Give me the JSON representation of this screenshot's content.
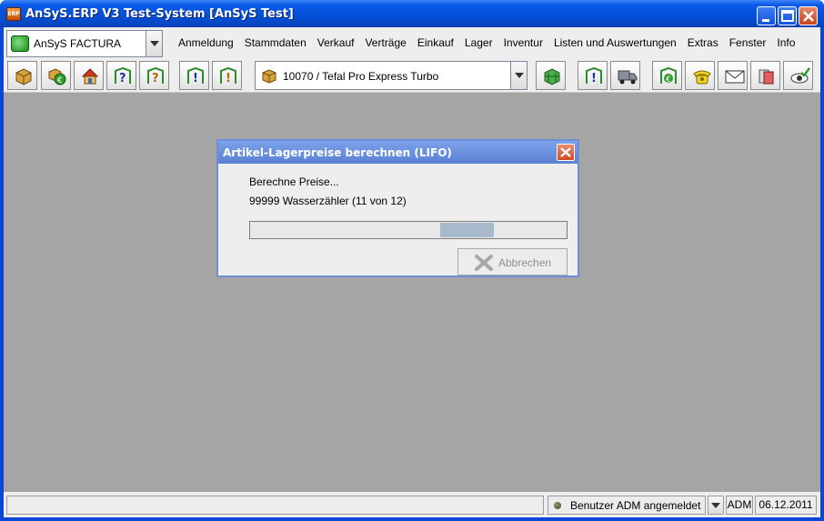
{
  "window": {
    "title": "AnSyS.ERP V3 Test-System [AnSyS Test]",
    "app_icon_text": "ERP",
    "controls": [
      "minimize-icon",
      "maximize-icon",
      "close-icon"
    ]
  },
  "menubar": {
    "module_select": {
      "value": "AnSyS FACTURA",
      "icon": "factura-module-icon"
    },
    "items": [
      {
        "label": "Anmeldung"
      },
      {
        "label": "Stammdaten"
      },
      {
        "label": "Verkauf"
      },
      {
        "label": "Verträge"
      },
      {
        "label": "Einkauf"
      },
      {
        "label": "Lager"
      },
      {
        "label": "Inventur"
      },
      {
        "label": "Listen und Auswertungen"
      },
      {
        "label": "Extras"
      },
      {
        "label": "Fenster"
      },
      {
        "label": "Info"
      }
    ]
  },
  "toolbar": {
    "article_select": {
      "value": "10070 / Tefal Pro Express Turbo",
      "icon": "article-box-icon"
    },
    "buttons_left": [
      "article-box-icon",
      "article-euro-icon",
      "warehouse-home-icon",
      "article-question-icon",
      "article-search-question-icon",
      "info-exclamation-icon",
      "search-info-icon"
    ],
    "buttons_right": [
      "stock-grid-icon",
      "order-info-icon",
      "delivery-truck-icon",
      "euro-refresh-icon",
      "telephone-icon",
      "envelope-icon",
      "documents-icon",
      "view-check-icon"
    ]
  },
  "dialog": {
    "title": "Artikel-Lagerpreise berechnen (LIFO)",
    "message": "Berechne Preise...",
    "current_item": "99999 Wasserzähler (11 von 12)",
    "progress": {
      "fill_start": 0.6,
      "fill_end": 0.77
    },
    "cancel_label": "Abbrechen"
  },
  "statusbar": {
    "main_text": "",
    "user_status": "Benutzer ADM angemeldet",
    "user_code": "ADM",
    "date": "06.12.2011"
  },
  "colors": {
    "titlebar": "#0552d8",
    "workspace": "#a5a5a5",
    "dialog_title": "#6a8fdf",
    "progress_fill": "#a9b9cc"
  }
}
